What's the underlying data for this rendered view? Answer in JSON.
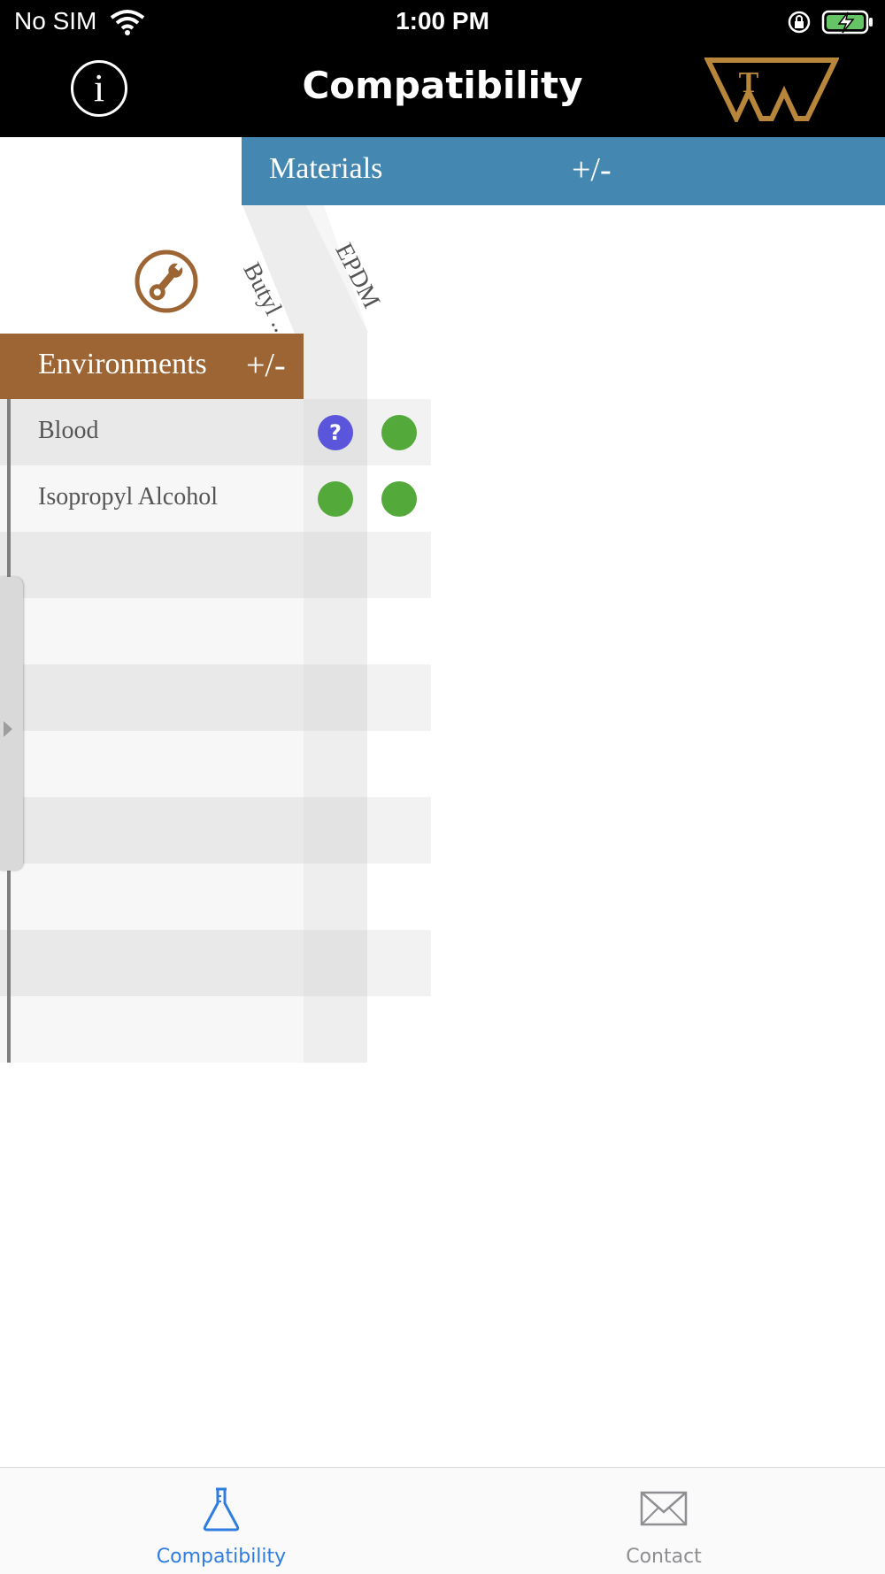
{
  "status_bar": {
    "carrier": "No SIM",
    "time": "1:00 PM"
  },
  "nav": {
    "title": "Compatibility",
    "info_glyph": "i",
    "logo_letter": "T"
  },
  "materials_header": {
    "label": "Materials",
    "toggle": "+/-"
  },
  "environments_header": {
    "label": "Environments",
    "toggle": "+/-"
  },
  "materials": [
    "Butyl ...",
    "EPDM"
  ],
  "environments": [
    {
      "name": "Blood",
      "ratings": [
        "unknown",
        "compatible"
      ]
    },
    {
      "name": "Isopropyl Alcohol",
      "ratings": [
        "compatible",
        "compatible"
      ]
    }
  ],
  "unknown_glyph": "?",
  "colors": {
    "materials_bar": "#4488b2",
    "environments_bar": "#9c6533",
    "compatible": "#53a93a",
    "unknown": "#5b55db",
    "tab_active": "#2f7de1",
    "tab_inactive": "#8e8e93"
  },
  "tabs": [
    {
      "label": "Compatibility",
      "icon": "flask-icon",
      "active": true
    },
    {
      "label": "Contact",
      "icon": "envelope-icon",
      "active": false
    }
  ]
}
